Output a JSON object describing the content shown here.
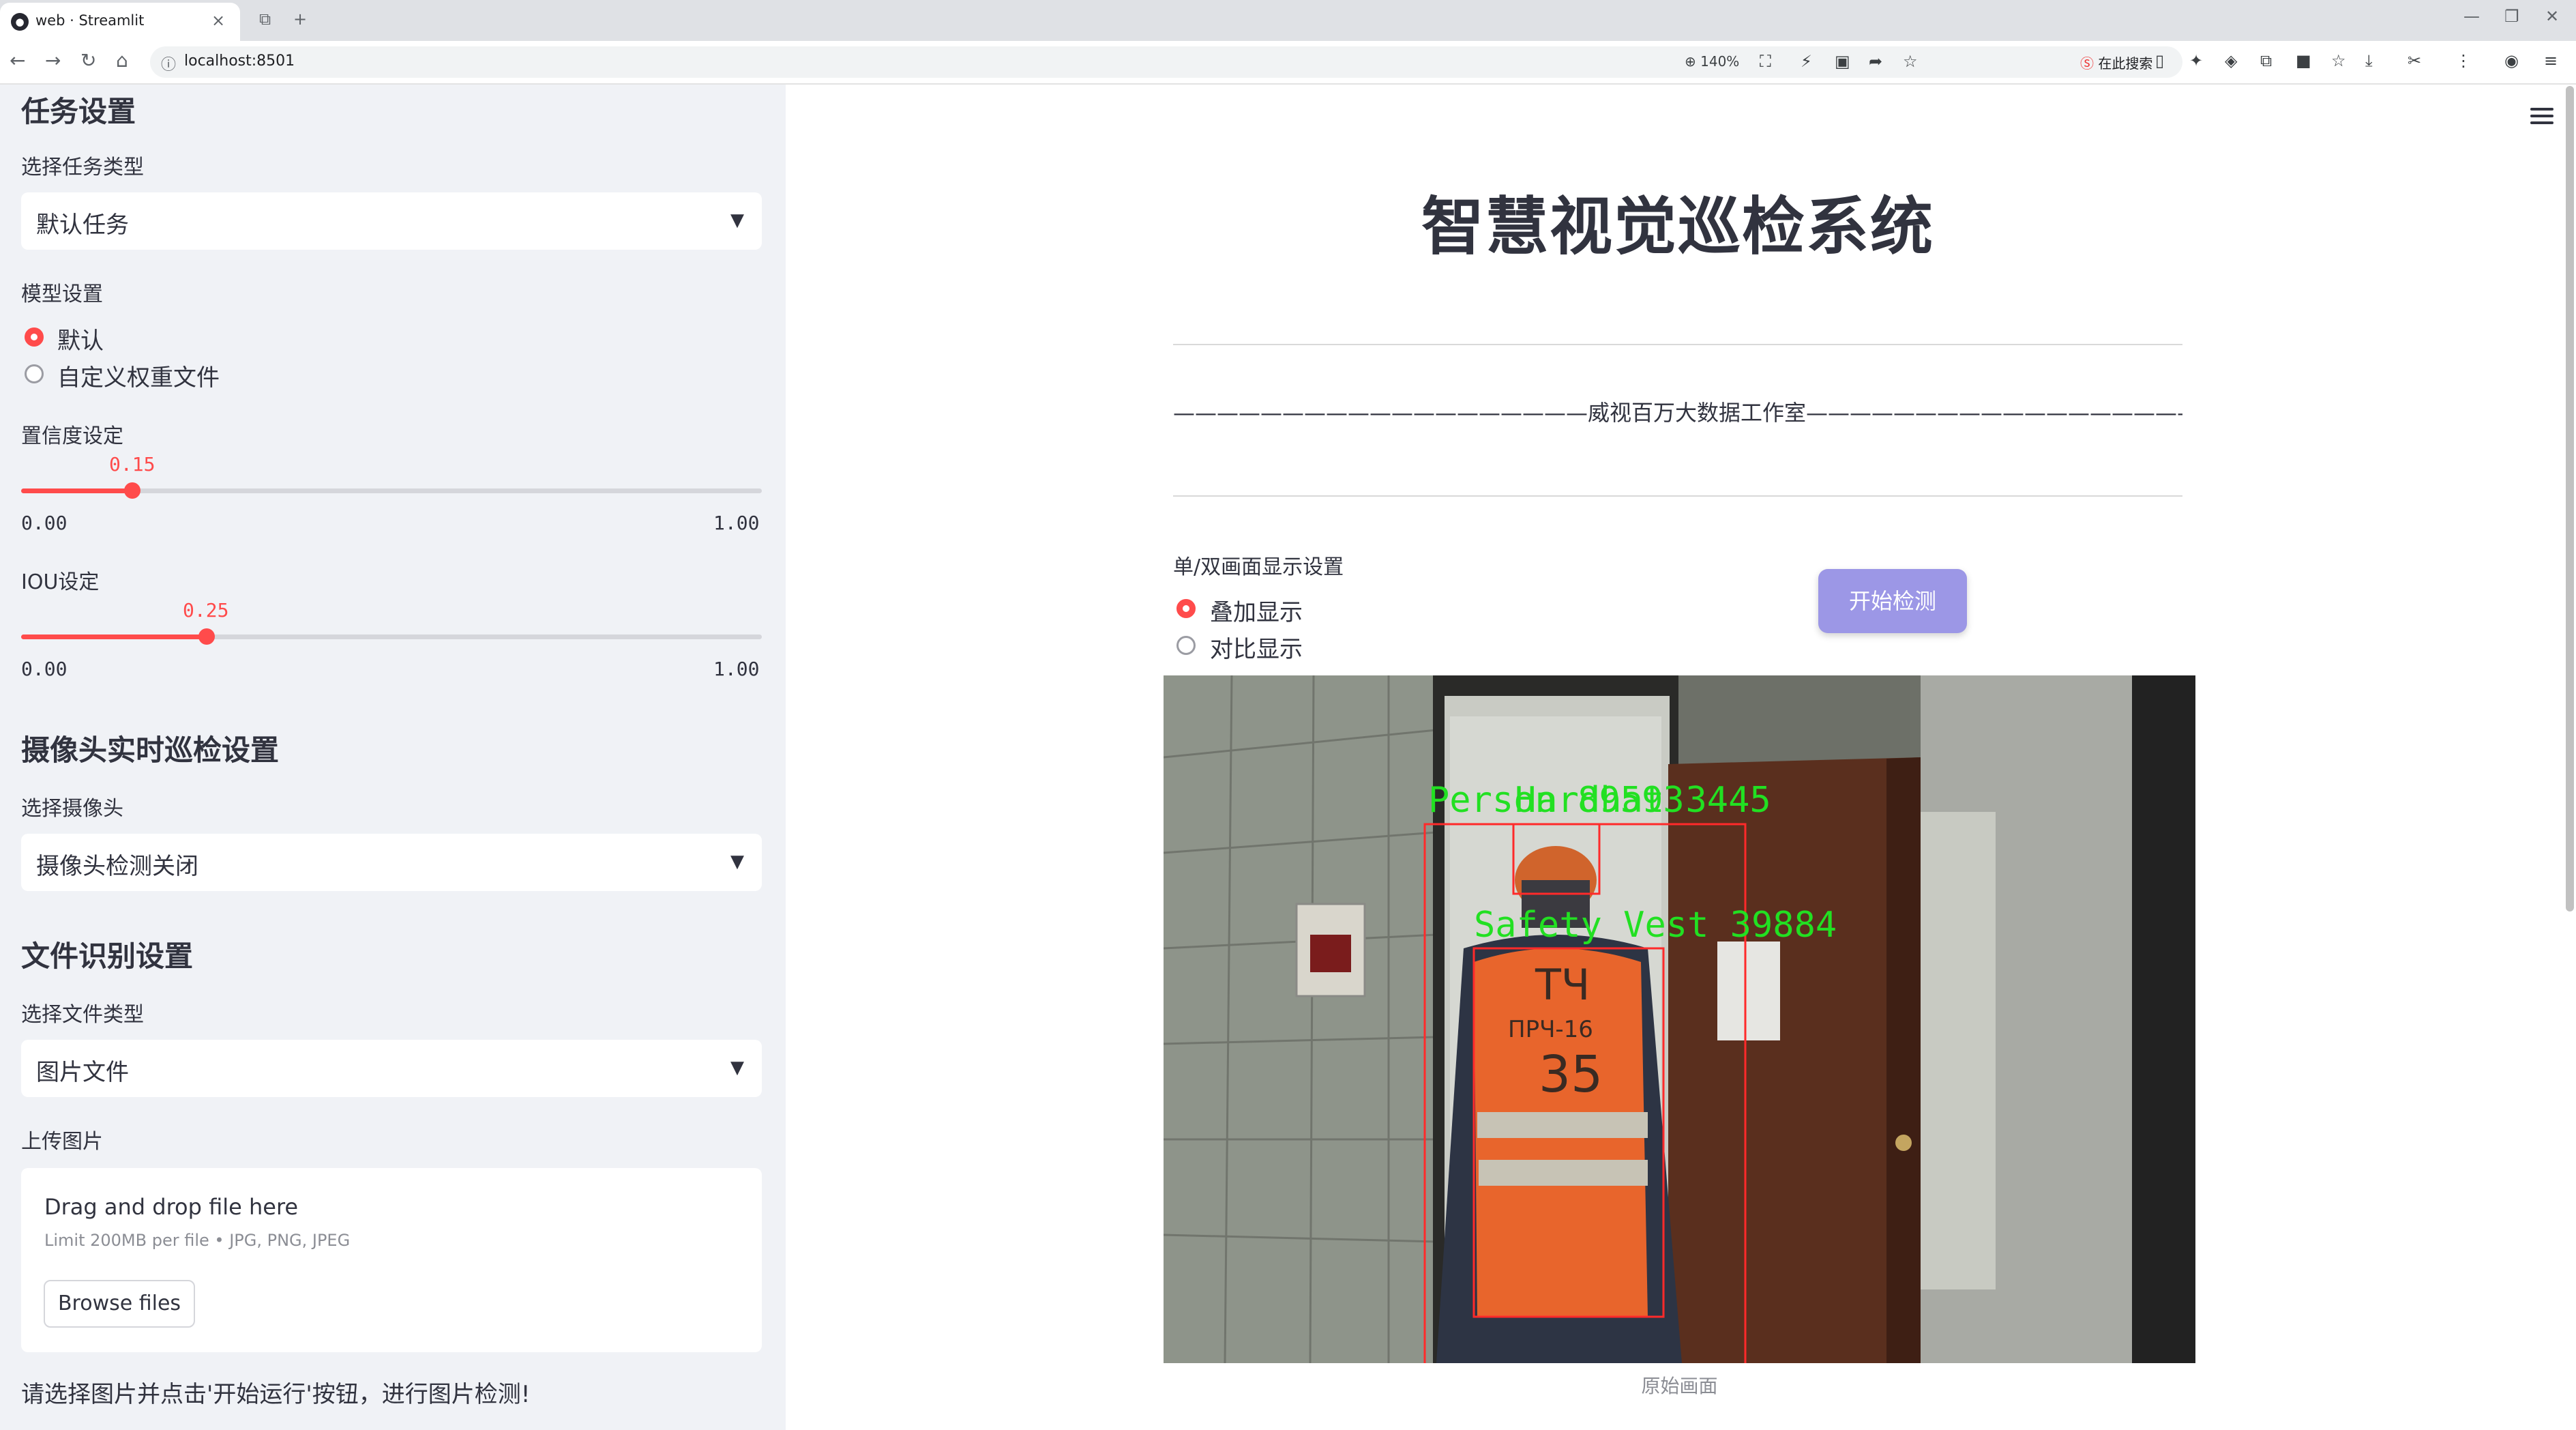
{
  "browser": {
    "tab_title": "web · Streamlit",
    "url": "localhost:8501",
    "zoom": "140%",
    "search_placeholder": "在此搜索"
  },
  "sidebar": {
    "task_section": {
      "heading": "任务设置",
      "task_type_label": "选择任务类型",
      "task_type_value": "默认任务",
      "model_label": "模型设置",
      "model_options": [
        {
          "label": "默认",
          "selected": true
        },
        {
          "label": "自定义权重文件",
          "selected": false
        }
      ],
      "confidence": {
        "label": "置信度设定",
        "value": "0.15",
        "fraction": 0.15,
        "min": "0.00",
        "max": "1.00"
      },
      "iou": {
        "label": "IOU设定",
        "value": "0.25",
        "fraction": 0.25,
        "min": "0.00",
        "max": "1.00"
      }
    },
    "camera_section": {
      "heading": "摄像头实时巡检设置",
      "camera_label": "选择摄像头",
      "camera_value": "摄像头检测关闭"
    },
    "file_section": {
      "heading": "文件识别设置",
      "file_type_label": "选择文件类型",
      "file_type_value": "图片文件",
      "upload_label": "上传图片",
      "uploader_title": "Drag and drop file here",
      "uploader_limits": "Limit 200MB per file • JPG, PNG, JPEG",
      "browse_button": "Browse files"
    },
    "hint": "请选择图片并点击'开始运行'按钮，进行图片检测!"
  },
  "main": {
    "title": "智慧视觉巡检系统",
    "subtitle": "———————————————————威视百万大数据工作室——————————————————",
    "display_label": "单/双画面显示设置",
    "display_options": [
      {
        "label": "叠加显示",
        "selected": true
      },
      {
        "label": "对比显示",
        "selected": false
      }
    ],
    "start_button": "开始检测",
    "image_caption": "原始画面",
    "detections": [
      {
        "label": "Person 89593",
        "color": "#ff0000"
      },
      {
        "label": "Hardhat 3445",
        "color": "#ff0000"
      },
      {
        "label": "Safety Vest 39884",
        "color": "#ff0000"
      }
    ]
  },
  "colors": {
    "accent": "#ff4b4b",
    "sidebar_bg": "#f0f2f6",
    "button": "#9c97e6",
    "detection_text": "#22e022"
  }
}
